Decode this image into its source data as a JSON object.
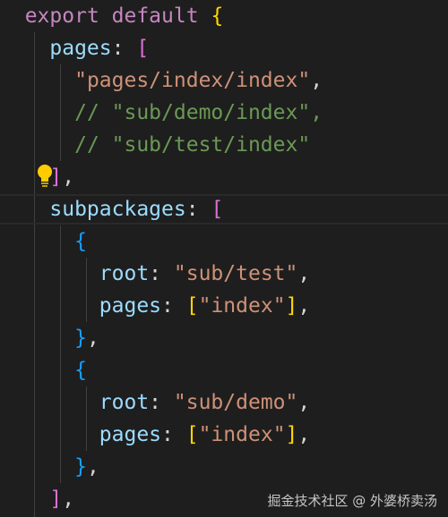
{
  "code": {
    "line1": {
      "kw": "export default",
      "brace": "{"
    },
    "line2": {
      "prop": "pages",
      "colon": ":",
      "bracket": "["
    },
    "line3": {
      "str": "\"pages/index/index\"",
      "comma": ","
    },
    "line4": {
      "comment": "// \"sub/demo/index\","
    },
    "line5": {
      "comment": "// \"sub/test/index\""
    },
    "line6": {
      "bracket": "]",
      "comma": ","
    },
    "line7": {
      "prop": "subpackages",
      "colon": ":",
      "bracket": "["
    },
    "line8": {
      "brace": "{"
    },
    "line9": {
      "prop": "root",
      "colon": ":",
      "str": "\"sub/test\"",
      "comma": ","
    },
    "line10": {
      "prop": "pages",
      "colon": ":",
      "bracket_open": "[",
      "str": "\"index\"",
      "bracket_close": "]",
      "comma": ","
    },
    "line11": {
      "brace": "}",
      "comma": ","
    },
    "line12": {
      "brace": "{"
    },
    "line13": {
      "prop": "root",
      "colon": ":",
      "str": "\"sub/demo\"",
      "comma": ","
    },
    "line14": {
      "prop": "pages",
      "colon": ":",
      "bracket_open": "[",
      "str": "\"index\"",
      "bracket_close": "]",
      "comma": ","
    },
    "line15": {
      "brace": "}",
      "comma": ","
    },
    "line16": {
      "bracket": "]",
      "comma": ","
    }
  },
  "lightbulb_icon": "lightbulb-icon",
  "watermark": "掘金技术社区 @ 外婆桥卖汤",
  "colors": {
    "background": "#1e1e1e",
    "keyword": "#c586c0",
    "property": "#9cdcfe",
    "string": "#ce9178",
    "comment": "#6a9955",
    "bracket_gold": "#ffd700",
    "bracket_orchid": "#da70d6",
    "bracket_blue": "#179fff",
    "lightbulb": "#ffcc00"
  }
}
